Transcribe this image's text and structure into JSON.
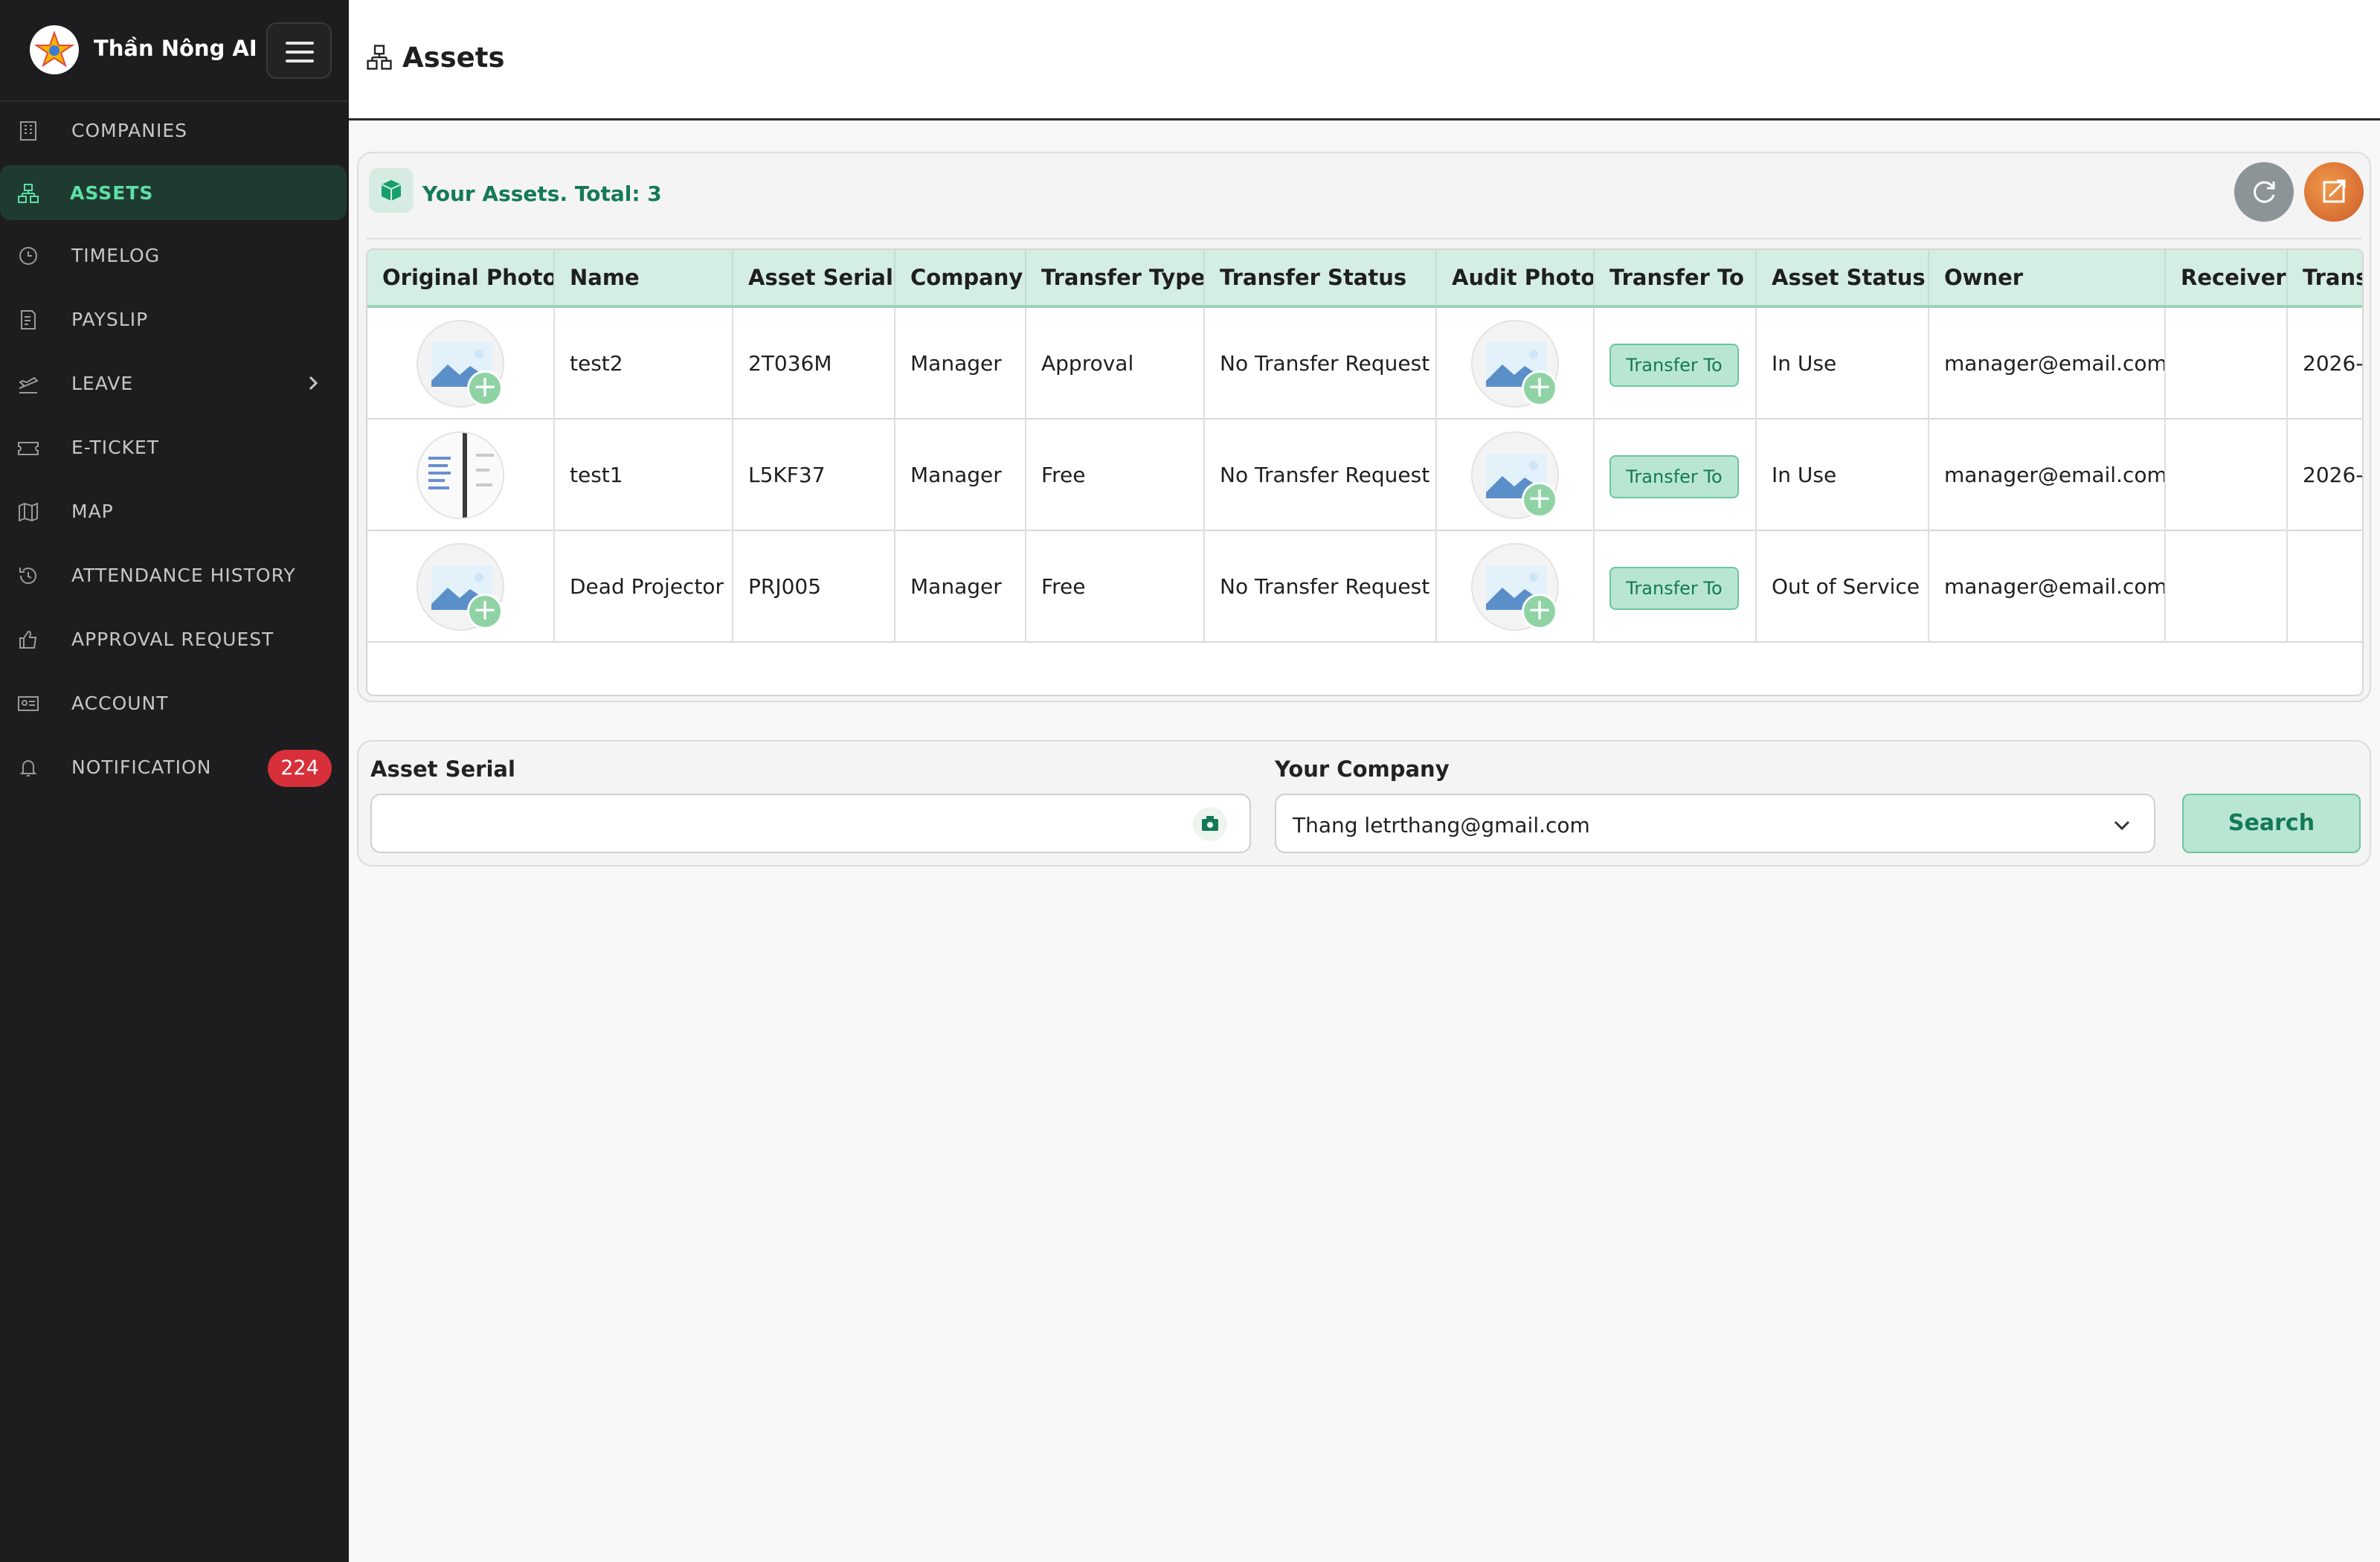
{
  "app": {
    "name": "Thần Nông AI"
  },
  "sidebar": {
    "items": [
      {
        "label": "COMPANIES",
        "icon": "building-icon"
      },
      {
        "label": "ASSETS",
        "icon": "assets-icon",
        "active": true
      },
      {
        "label": "TIMELOG",
        "icon": "clock-icon"
      },
      {
        "label": "PAYSLIP",
        "icon": "receipt-icon"
      },
      {
        "label": "LEAVE",
        "icon": "plane-icon",
        "expandable": true
      },
      {
        "label": "E-TICKET",
        "icon": "ticket-icon"
      },
      {
        "label": "MAP",
        "icon": "map-icon"
      },
      {
        "label": "ATTENDANCE HISTORY",
        "icon": "history-icon"
      },
      {
        "label": "APPROVAL REQUEST",
        "icon": "thumbs-up-icon"
      },
      {
        "label": "ACCOUNT",
        "icon": "id-card-icon"
      },
      {
        "label": "NOTIFICATION",
        "icon": "bell-icon",
        "badge": "224"
      }
    ]
  },
  "header": {
    "title": "Assets",
    "icon": "assets-icon"
  },
  "assets_panel": {
    "title": "Your Assets. Total: 3",
    "columns": [
      "Original Photo",
      "Name",
      "Asset Serial",
      "Company",
      "Transfer Type",
      "Transfer Status",
      "Audit Photo",
      "Transfer To",
      "Asset Status",
      "Owner",
      "Receiver",
      "Trans"
    ],
    "rows": [
      {
        "name": "test2",
        "serial": "2T036M",
        "company": "Manager",
        "transfer_type": "Approval",
        "transfer_status": "No Transfer Request",
        "transfer_button": "Transfer To",
        "asset_status": "In Use",
        "owner": "manager@email.com",
        "receiver": "",
        "trans": "2026-"
      },
      {
        "name": "test1",
        "serial": "L5KF37",
        "company": "Manager",
        "transfer_type": "Free",
        "transfer_status": "No Transfer Request",
        "transfer_button": "Transfer To",
        "asset_status": "In Use",
        "owner": "manager@email.com",
        "receiver": "",
        "trans": "2026-"
      },
      {
        "name": "Dead Projector",
        "serial": "PRJ005",
        "company": "Manager",
        "transfer_type": "Free",
        "transfer_status": "No Transfer Request",
        "transfer_button": "Transfer To",
        "asset_status": "Out of Service",
        "owner": "manager@email.com",
        "receiver": "",
        "trans": ""
      }
    ]
  },
  "search": {
    "serial_label": "Asset Serial",
    "serial_value": "",
    "company_label": "Your Company",
    "company_value": "Thang letrthang@gmail.com",
    "button_label": "Search"
  },
  "colors": {
    "accent": "#137a55",
    "accent_light": "#b9e6d2",
    "sidebar_bg": "#1d1d1f",
    "badge": "#d7303a"
  }
}
